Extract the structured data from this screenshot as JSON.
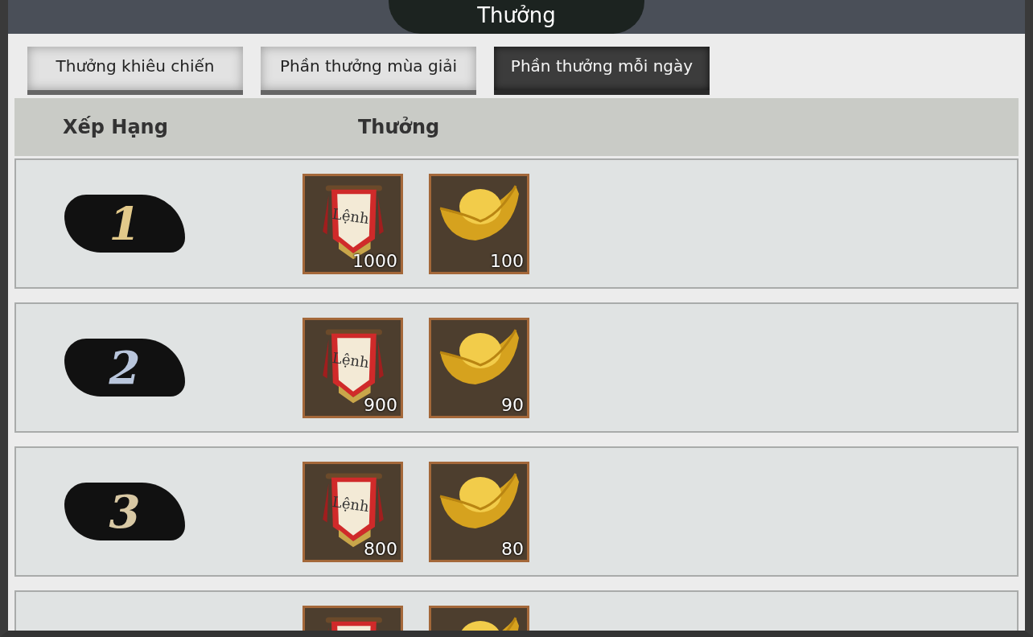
{
  "window": {
    "title": "Thưởng"
  },
  "tabs": [
    {
      "label": "Thưởng khiêu chiến",
      "selected": false
    },
    {
      "label": "Phần thưởng mùa giải",
      "selected": false
    },
    {
      "label": "Phần thưởng mỗi ngày",
      "selected": true
    }
  ],
  "table": {
    "columns": [
      "Xếp Hạng",
      "Thưởng"
    ],
    "rows": [
      {
        "rank": "1",
        "color": "#e2c98a",
        "items": [
          {
            "kind": "banner",
            "banner_text": "Lệnh",
            "count": "1000"
          },
          {
            "kind": "ingot",
            "count": "100"
          }
        ]
      },
      {
        "rank": "2",
        "color": "#b9c6dc",
        "items": [
          {
            "kind": "banner",
            "banner_text": "Lệnh",
            "count": "900"
          },
          {
            "kind": "ingot",
            "count": "90"
          }
        ]
      },
      {
        "rank": "3",
        "color": "#d8c8a4",
        "items": [
          {
            "kind": "banner",
            "banner_text": "Lệnh",
            "count": "800"
          },
          {
            "kind": "ingot",
            "count": "80"
          }
        ]
      },
      {
        "items": [
          {
            "kind": "banner"
          },
          {
            "kind": "ingot"
          }
        ]
      }
    ]
  }
}
